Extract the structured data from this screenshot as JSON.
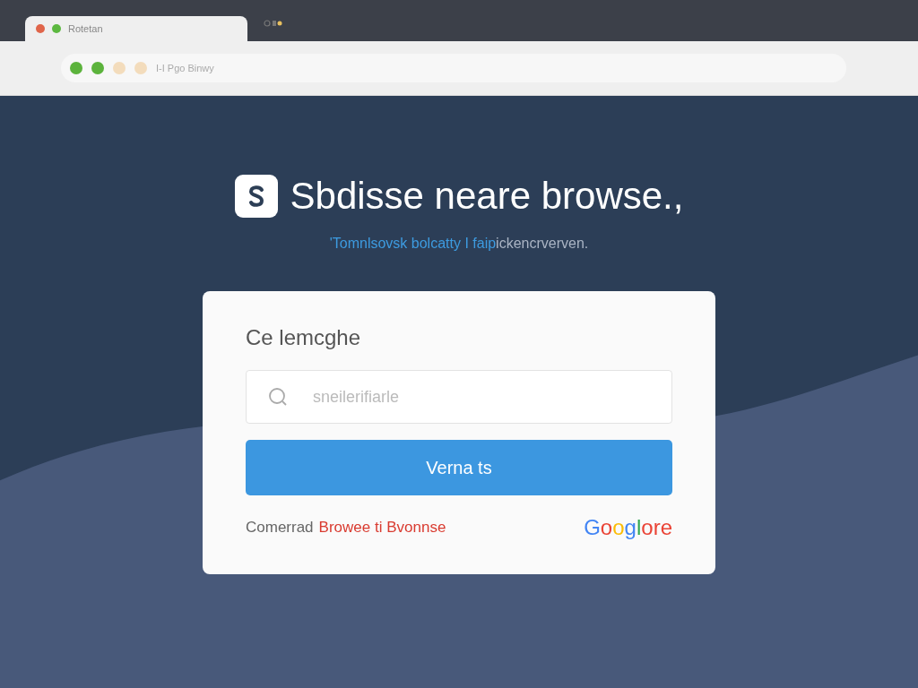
{
  "tab": {
    "title": "Rotetan",
    "dots": [
      {
        "color": "#e0654a"
      },
      {
        "color": "#5cb840"
      }
    ]
  },
  "address_bar": {
    "dots": [
      {
        "color": "#5cb33c"
      },
      {
        "color": "#5cb33c"
      },
      {
        "color": "#f3dcbc"
      },
      {
        "color": "#f3dcbc"
      }
    ],
    "value": "I-I Pgo Binwy"
  },
  "hero": {
    "title": "Sbdisse neare browse.,",
    "subtitle": "'Tomnlsovsk bolcatty I faip",
    "subtitle_rest": "ickencrverven."
  },
  "card": {
    "heading": "Ce lemcghe",
    "search": {
      "placeholder": "sneilerifiarle"
    },
    "button": "Verna ts",
    "footer_text": "Comerrad",
    "footer_link": "Browee ti Bvonnse",
    "logo": "Googlore"
  }
}
